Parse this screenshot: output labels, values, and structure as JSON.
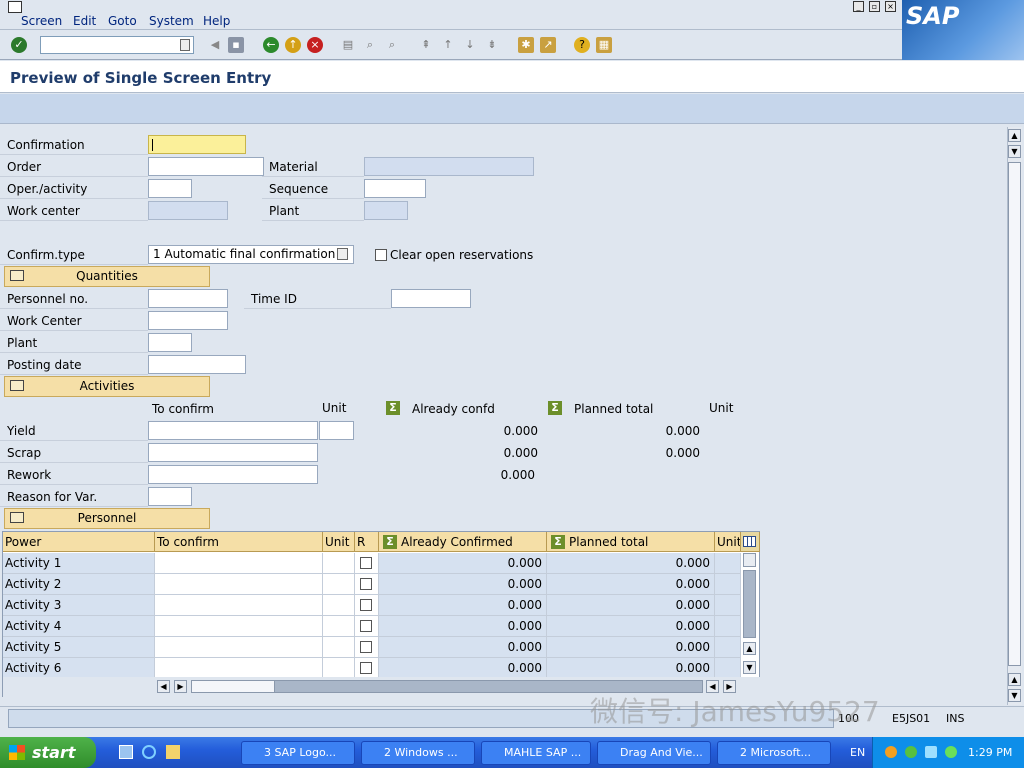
{
  "menu": {
    "items": [
      "Screen",
      "Edit",
      "Goto",
      "System",
      "Help"
    ]
  },
  "logo": "SAP",
  "page_title": "Preview of Single Screen Entry",
  "header": {
    "confirmation_label": "Confirmation",
    "order_label": "Order",
    "material_label": "Material",
    "oper_activity_label": "Oper./activity",
    "sequence_label": "Sequence",
    "work_center_label": "Work center",
    "plant_label": "Plant",
    "confirm_type_label": "Confirm.type",
    "confirm_type_value": "1 Automatic final confirmation",
    "clear_reservations_label": "Clear open reservations"
  },
  "quantities": {
    "section_label": "Quantities",
    "personnel_no_label": "Personnel no.",
    "time_id_label": "Time ID",
    "work_center_label": "Work Center",
    "plant_label": "Plant",
    "posting_date_label": "Posting date"
  },
  "activities": {
    "section_label": "Activities",
    "to_confirm_header": "To confirm",
    "unit_header": "Unit",
    "already_confd_header": "Already confd",
    "planned_total_header": "Planned total",
    "unit2_header": "Unit",
    "rows": [
      {
        "label": "Yield",
        "already": "0.000",
        "planned": "0.000"
      },
      {
        "label": "Scrap",
        "already": "0.000",
        "planned": "0.000"
      },
      {
        "label": "Rework",
        "already": "0.000",
        "planned": ""
      }
    ],
    "reason_label": "Reason for Var."
  },
  "personnel": {
    "section_label": "Personnel"
  },
  "table": {
    "columns": [
      "Power",
      "To confirm",
      "Unit",
      "R",
      "Already Confirmed",
      "Planned total",
      "Unit"
    ],
    "rows": [
      {
        "name": "Activity 1",
        "already": "0.000",
        "planned": "0.000"
      },
      {
        "name": "Activity 2",
        "already": "0.000",
        "planned": "0.000"
      },
      {
        "name": "Activity 3",
        "already": "0.000",
        "planned": "0.000"
      },
      {
        "name": "Activity 4",
        "already": "0.000",
        "planned": "0.000"
      },
      {
        "name": "Activity 5",
        "already": "0.000",
        "planned": "0.000"
      },
      {
        "name": "Activity 6",
        "already": "0.000",
        "planned": "0.000"
      }
    ]
  },
  "status": {
    "message": "",
    "session": "100",
    "server": "E5JS01",
    "mode": "INS"
  },
  "watermark": "微信号: JamesYu9527",
  "taskbar": {
    "start": "start",
    "tasks": [
      "3 SAP Logo...",
      "2 Windows ...",
      "MAHLE SAP ...",
      "Drag And Vie...",
      "2 Microsoft..."
    ],
    "lang": "EN",
    "clock": "1:29 PM"
  },
  "colors": {
    "required_field": "#fbf09a",
    "section_button": "#f5dfa7",
    "title_text": "#1f3c6b",
    "taskbar": "#245edb"
  }
}
